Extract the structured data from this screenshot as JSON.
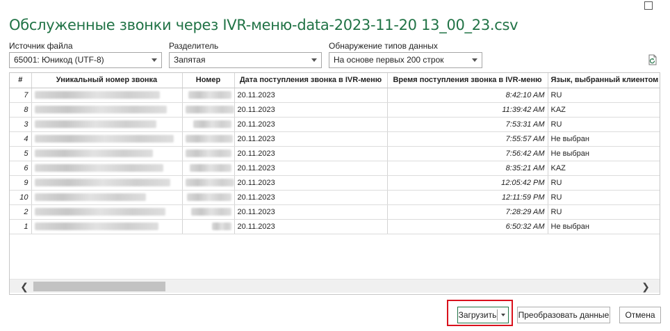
{
  "title": "Обслуженные звонки через IVR-меню-data-2023-11-20 13_00_23.csv",
  "source": {
    "label": "Источник файла",
    "value": "65001: Юникод (UTF-8)"
  },
  "delimiter": {
    "label": "Разделитель",
    "value": "Запятая"
  },
  "detection": {
    "label": "Обнаружение типов данных",
    "value": "На основе первых 200 строк"
  },
  "columns": [
    "#",
    "Уникальный номер звонка",
    "Номер",
    "Дата поступления звонка в IVR-меню",
    "Время поступления звонка в IVR-меню",
    "Язык, выбранный клиентом в I"
  ],
  "rows": [
    {
      "idx": "7",
      "date": "20.11.2023",
      "time": "8:42:10 AM",
      "lang": "RU"
    },
    {
      "idx": "8",
      "date": "20.11.2023",
      "time": "11:39:42 AM",
      "lang": "KAZ"
    },
    {
      "idx": "3",
      "date": "20.11.2023",
      "time": "7:53:31 AM",
      "lang": "RU"
    },
    {
      "idx": "4",
      "date": "20.11.2023",
      "time": "7:55:57 AM",
      "lang": "Не выбран"
    },
    {
      "idx": "5",
      "date": "20.11.2023",
      "time": "7:56:42 AM",
      "lang": "Не выбран"
    },
    {
      "idx": "6",
      "date": "20.11.2023",
      "time": "8:35:21 AM",
      "lang": "KAZ"
    },
    {
      "idx": "9",
      "date": "20.11.2023",
      "time": "12:05:42 PM",
      "lang": "RU"
    },
    {
      "idx": "10",
      "date": "20.11.2023",
      "time": "12:11:59 PM",
      "lang": "RU"
    },
    {
      "idx": "2",
      "date": "20.11.2023",
      "time": "7:28:29 AM",
      "lang": "RU"
    },
    {
      "idx": "1",
      "date": "20.11.2023",
      "time": "6:50:32 AM",
      "lang": "Не выбран"
    }
  ],
  "buttons": {
    "load": "Загрузить",
    "transform": "Преобразовать данные",
    "cancel": "Отмена"
  },
  "colors": {
    "title": "#217346",
    "highlight": "#d9111c"
  }
}
